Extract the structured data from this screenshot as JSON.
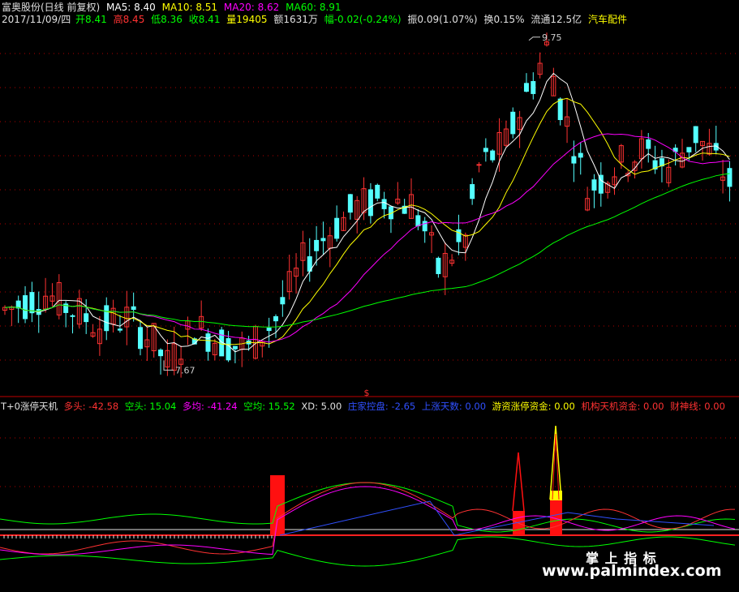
{
  "header1": {
    "title": "富奥股份(日线 前复权)",
    "ma5": "MA5: 8.40",
    "ma10": "MA10: 8.51",
    "ma20": "MA20: 8.62",
    "ma60": "MA60: 8.91"
  },
  "header2": {
    "date": "2017/11/09/四",
    "open": "开8.41",
    "high": "高8.45",
    "low": "低8.36",
    "close": "收8.41",
    "vol": "量19405",
    "amount": "额1631万",
    "change": "幅-0.02(-0.24%)",
    "amplitude": "振0.09(1.07%)",
    "turnover": "换0.15%",
    "float": "流通12.5亿",
    "sector": "汽车配件"
  },
  "price_labels": {
    "high": "9.75",
    "low": "7.67",
    "marker": "$"
  },
  "indicator_header": {
    "name": "T+0涨停天机",
    "duotou": "多头: -42.58",
    "kongtou": "空头: 15.04",
    "duojun": "多均: -41.24",
    "kongjun": "空均: 15.52",
    "xd": "XD: 5.00",
    "zhuangjia": "庄家控盘: -2.65",
    "shangzhang": "上涨天数: 0.00",
    "youzi": "游资涨停资金: 0.00",
    "jigou": "机构天机资金: 0.00",
    "caishen": "财神线: 0.00"
  },
  "watermark": {
    "cn": "掌 上 指 标",
    "url": "www.palmindex.com"
  },
  "colors": {
    "up": "#ff3232",
    "down": "#54ffff",
    "ma5": "#ffffff",
    "ma10": "#ffff00",
    "ma20": "#ff00ff",
    "ma60": "#00ff00",
    "grid": "#b00000",
    "axis": "#c00000"
  },
  "chart_data": {
    "type": "candlestick",
    "price_range": [
      7.6,
      9.8
    ],
    "labeled_high": 9.75,
    "labeled_low": 7.67,
    "indicator_series": [
      "多头",
      "空头",
      "多均",
      "空均",
      "庄家控盘",
      "游资涨停资金",
      "机构天机资金"
    ]
  }
}
